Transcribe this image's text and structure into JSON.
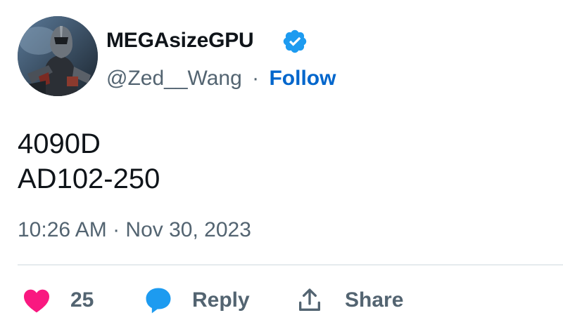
{
  "author": {
    "display_name": "MEGAsizeGPU",
    "handle": "@Zed__Wang",
    "separator": "·",
    "follow_label": "Follow",
    "verified": true
  },
  "tweet": {
    "lines": [
      "4090D",
      "AD102-250"
    ],
    "timestamp": "10:26 AM · Nov 30, 2023"
  },
  "actions": {
    "like_count": "25",
    "reply_label": "Reply",
    "share_label": "Share"
  },
  "colors": {
    "like": "#f91880",
    "reply": "#1d9bf0",
    "follow": "#0066cc",
    "verified": "#1d9bf0",
    "secondary_text": "#536471",
    "divider": "#cfd9de"
  },
  "icons": {
    "verified": "verified-badge-icon",
    "like": "heart-icon",
    "reply": "speech-bubble-icon",
    "share": "share-upload-icon"
  }
}
